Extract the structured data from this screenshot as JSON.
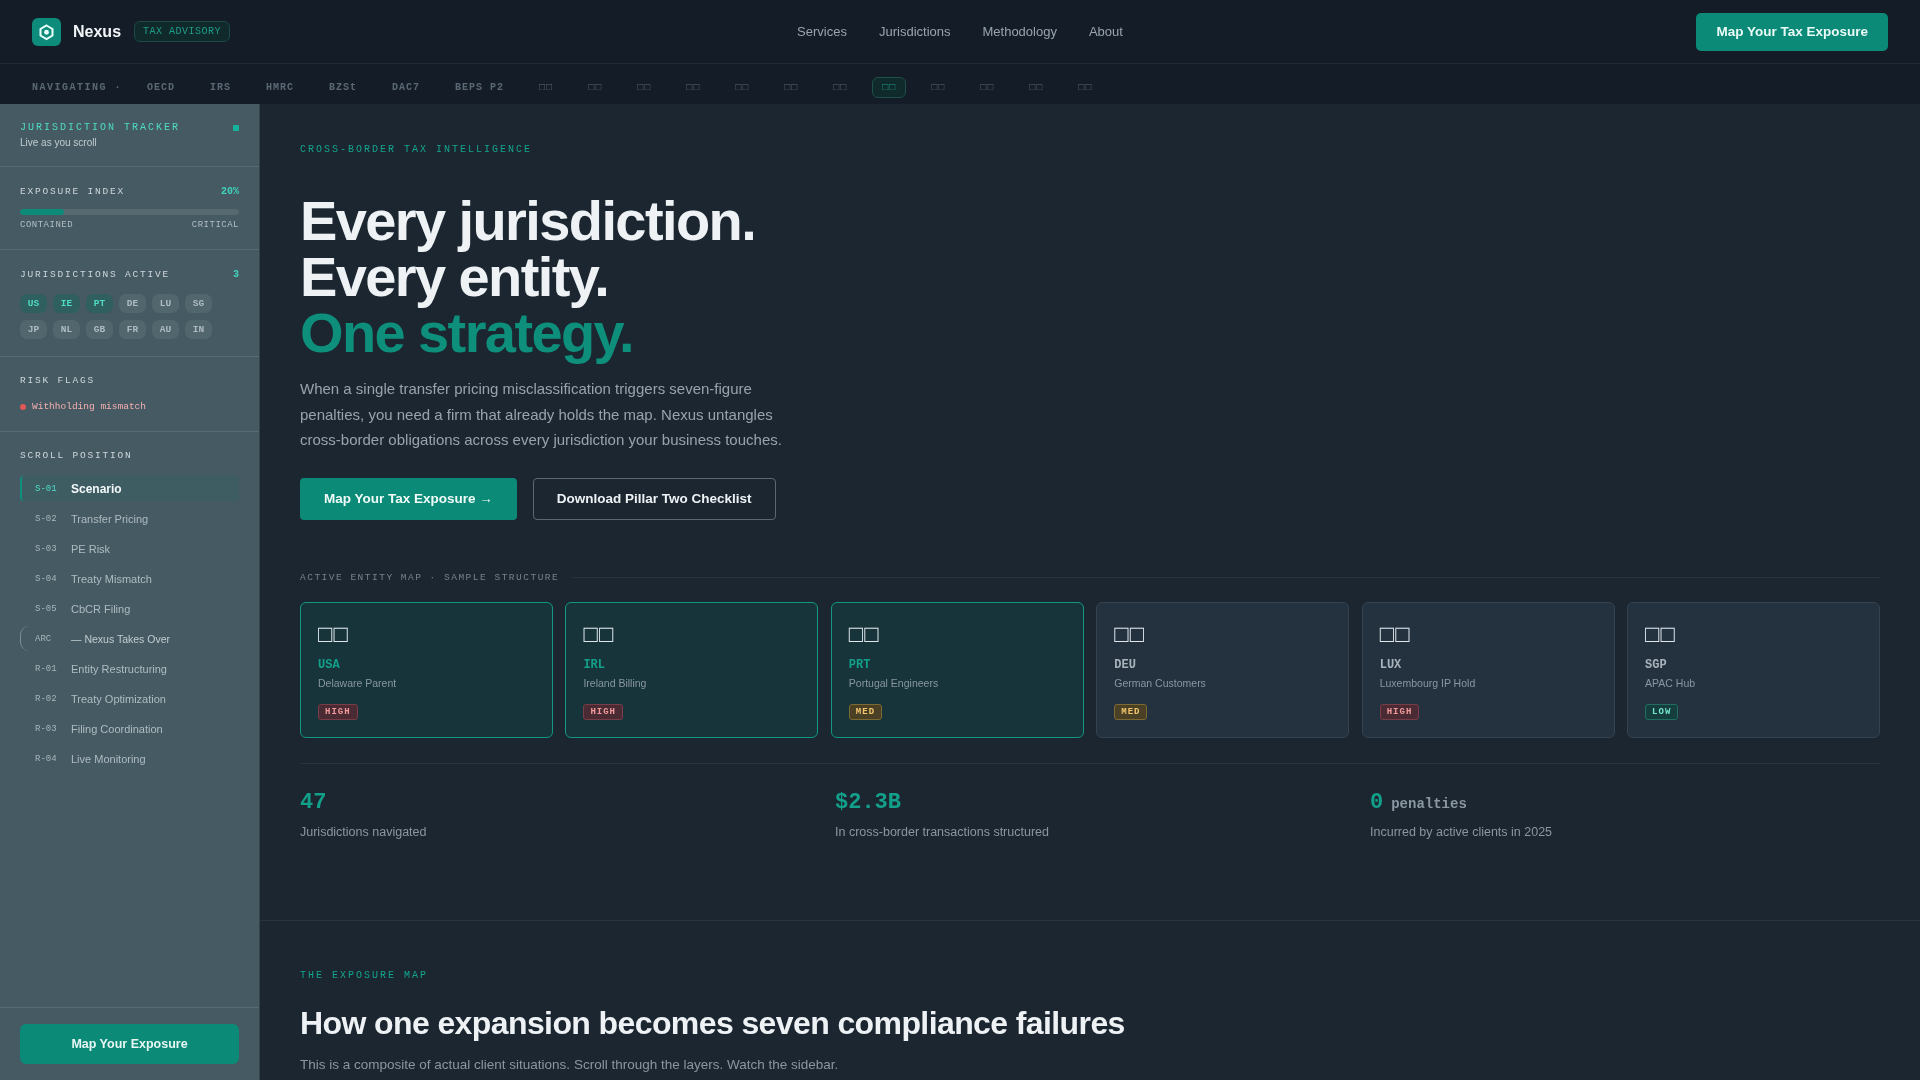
{
  "header": {
    "brand": "Nexus",
    "tag": "TAX ADVISORY",
    "nav": [
      "Services",
      "Jurisdictions",
      "Methodology",
      "About"
    ],
    "cta": "Map Your Tax Exposure"
  },
  "ticker": {
    "label": "NAVIGATING ·",
    "items": [
      {
        "label": "OECD",
        "selected": false
      },
      {
        "label": "IRS",
        "selected": false
      },
      {
        "label": "HMRC",
        "selected": false
      },
      {
        "label": "BZSt",
        "selected": false
      },
      {
        "label": "DAC7",
        "selected": false
      },
      {
        "label": "BEPS P2",
        "selected": false
      },
      {
        "label": "□□",
        "selected": false
      },
      {
        "label": "□□",
        "selected": false
      },
      {
        "label": "□□",
        "selected": false
      },
      {
        "label": "□□",
        "selected": false
      },
      {
        "label": "□□",
        "selected": false
      },
      {
        "label": "□□",
        "selected": false
      },
      {
        "label": "□□",
        "selected": false
      },
      {
        "label": "□□",
        "selected": true
      },
      {
        "label": "□□",
        "selected": false
      },
      {
        "label": "□□",
        "selected": false
      },
      {
        "label": "□□",
        "selected": false
      },
      {
        "label": "□□",
        "selected": false
      }
    ]
  },
  "sidebar": {
    "tracker": {
      "title": "JURISDICTION TRACKER",
      "subtitle": "Live as you scroll"
    },
    "exposure": {
      "title": "EXPOSURE INDEX",
      "reading": "20%",
      "level": 0.2,
      "low_label": "CONTAINED",
      "high_label": "CRITICAL"
    },
    "jurisdictions": {
      "title": "JURISDICTIONS ACTIVE",
      "count": "3",
      "chips": [
        {
          "label": "US",
          "on": true
        },
        {
          "label": "IE",
          "on": true
        },
        {
          "label": "PT",
          "on": true
        },
        {
          "label": "DE",
          "on": false
        },
        {
          "label": "LU",
          "on": false
        },
        {
          "label": "SG",
          "on": false
        },
        {
          "label": "JP",
          "on": false
        },
        {
          "label": "NL",
          "on": false
        },
        {
          "label": "GB",
          "on": false
        },
        {
          "label": "FR",
          "on": false
        },
        {
          "label": "AU",
          "on": false
        },
        {
          "label": "IN",
          "on": false
        }
      ]
    },
    "risk_flags": {
      "title": "RISK FLAGS",
      "items": [
        "Withholding mismatch"
      ]
    },
    "scroll_position": {
      "title": "SCROLL POSITION",
      "items": [
        {
          "kind": "step",
          "code": "S-01",
          "label": "Scenario",
          "selected": true
        },
        {
          "kind": "step",
          "code": "S-02",
          "label": "Transfer Pricing",
          "selected": false
        },
        {
          "kind": "step",
          "code": "S-03",
          "label": "PE Risk",
          "selected": false
        },
        {
          "kind": "step",
          "code": "S-04",
          "label": "Treaty Mismatch",
          "selected": false
        },
        {
          "kind": "step",
          "code": "S-05",
          "label": "CbCR Filing",
          "selected": false
        },
        {
          "kind": "arc",
          "code": "ARC",
          "label": "— Nexus Takes Over",
          "selected": false
        },
        {
          "kind": "step",
          "code": "R-01",
          "label": "Entity Restructuring",
          "selected": false
        },
        {
          "kind": "step",
          "code": "R-02",
          "label": "Treaty Optimization",
          "selected": false
        },
        {
          "kind": "step",
          "code": "R-03",
          "label": "Filing Coordination",
          "selected": false
        },
        {
          "kind": "step",
          "code": "R-04",
          "label": "Live Monitoring",
          "selected": false
        }
      ]
    },
    "cta": "Map Your Exposure"
  },
  "hero": {
    "eyebrow": "CROSS-BORDER TAX INTELLIGENCE",
    "title_lines": [
      {
        "text": "Every jurisdiction.",
        "accent": false
      },
      {
        "text": "Every entity.",
        "accent": false
      },
      {
        "text": "One strategy.",
        "accent": true
      }
    ],
    "body": "When a single transfer pricing misclassification triggers seven-figure penalties, you need a firm that already holds the map. Nexus untangles cross-border obligations across every jurisdiction your business touches.",
    "buttons": [
      {
        "kind": "primary",
        "label": "Map Your Tax Exposure →"
      },
      {
        "kind": "secondary",
        "label": "Download Pillar Two Checklist"
      }
    ]
  },
  "entity_map": {
    "title": "ACTIVE ENTITY MAP · SAMPLE STRUCTURE",
    "entities": [
      {
        "flag": "□□",
        "code": "USA",
        "name": "Delaware Parent",
        "risk": "HIGH",
        "kind": "high",
        "active": true
      },
      {
        "flag": "□□",
        "code": "IRL",
        "name": "Ireland Billing",
        "risk": "HIGH",
        "kind": "high",
        "active": true
      },
      {
        "flag": "□□",
        "code": "PRT",
        "name": "Portugal Engineers",
        "risk": "MED",
        "kind": "med",
        "active": true
      },
      {
        "flag": "□□",
        "code": "DEU",
        "name": "German Customers",
        "risk": "MED",
        "kind": "med",
        "active": false
      },
      {
        "flag": "□□",
        "code": "LUX",
        "name": "Luxembourg IP Hold",
        "risk": "HIGH",
        "kind": "high",
        "active": false
      },
      {
        "flag": "□□",
        "code": "SGP",
        "name": "APAC Hub",
        "risk": "LOW",
        "kind": "low",
        "active": false
      }
    ]
  },
  "stats": [
    {
      "value": "47",
      "label": "Jurisdictions navigated"
    },
    {
      "value": "$2.3B",
      "label": "In cross-border transactions structured"
    },
    {
      "value": "0",
      "unit": "penalties",
      "label": "Incurred by active clients in 2025"
    }
  ],
  "exposure_map": {
    "eyebrow": "THE EXPOSURE MAP",
    "title": "How one expansion becomes seven compliance failures",
    "body": "This is a composite of actual client situations. Scroll through the layers. Watch the sidebar."
  }
}
